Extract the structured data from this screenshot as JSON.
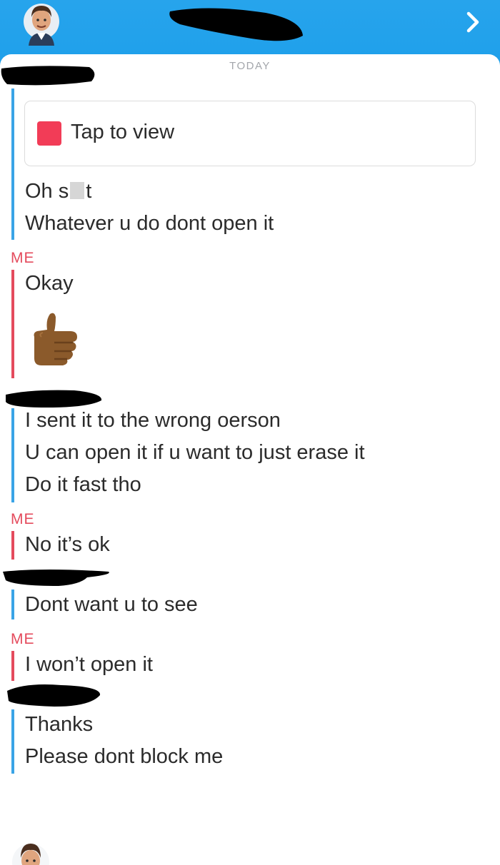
{
  "header": {
    "avatar_icon": "bitmoji-avatar-icon",
    "forward_icon": "chevron-right-icon"
  },
  "date_divider": "TODAY",
  "snap": {
    "label": "Tap to view",
    "color": "#f23c57"
  },
  "messages": [
    {
      "sender": "friend",
      "lines": [
        "Oh s",
        "t",
        "Whatever u do dont open it"
      ]
    },
    {
      "sender": "ME",
      "lines": [
        "Okay"
      ],
      "emoji": "thumbs-up-icon"
    },
    {
      "sender": "friend",
      "lines": [
        "I sent it to the wrong oerson",
        "U can open it if u want to just erase it",
        "Do it fast tho"
      ]
    },
    {
      "sender": "ME",
      "lines": [
        "No it’s ok"
      ]
    },
    {
      "sender": "friend",
      "lines": [
        "Dont want u to see"
      ]
    },
    {
      "sender": "ME",
      "lines": [
        "I won’t open it"
      ]
    },
    {
      "sender": "friend",
      "lines": [
        "Thanks",
        "Please dont block me"
      ]
    }
  ],
  "colors": {
    "header": "#1d9fea",
    "me": "#e44b5d",
    "friend": "#3aa4e6"
  }
}
